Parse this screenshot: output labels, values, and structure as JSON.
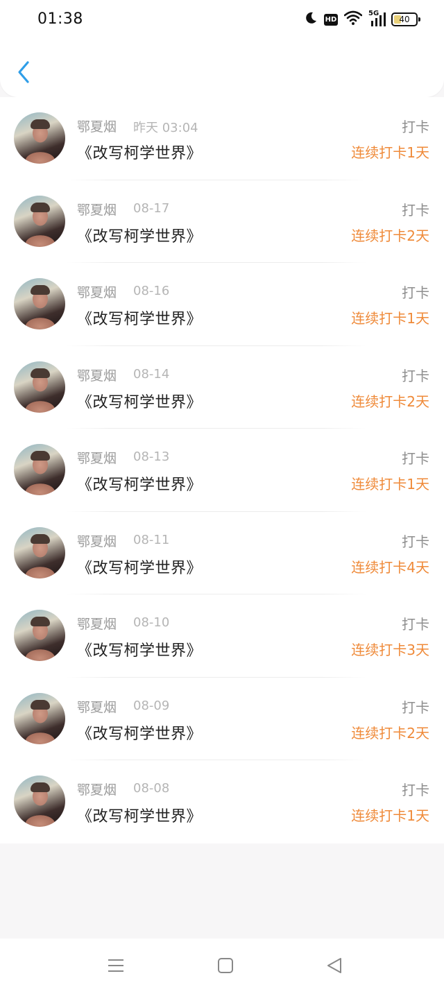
{
  "status_bar": {
    "time": "01:38",
    "hd_label": "HD",
    "network_label": "5G",
    "battery_percent": "40",
    "battery_level": 0.4
  },
  "header": {
    "back_icon": "chevron-left-icon",
    "accent_color": "#2f9ee8"
  },
  "entries": [
    {
      "name": "鄂夏烟",
      "date": "昨天 03:04",
      "title": "《改写柯学世界》",
      "type": "打卡",
      "streak": "连续打卡1天"
    },
    {
      "name": "鄂夏烟",
      "date": "08-17",
      "title": "《改写柯学世界》",
      "type": "打卡",
      "streak": "连续打卡2天"
    },
    {
      "name": "鄂夏烟",
      "date": "08-16",
      "title": "《改写柯学世界》",
      "type": "打卡",
      "streak": "连续打卡1天"
    },
    {
      "name": "鄂夏烟",
      "date": "08-14",
      "title": "《改写柯学世界》",
      "type": "打卡",
      "streak": "连续打卡2天"
    },
    {
      "name": "鄂夏烟",
      "date": "08-13",
      "title": "《改写柯学世界》",
      "type": "打卡",
      "streak": "连续打卡1天"
    },
    {
      "name": "鄂夏烟",
      "date": "08-11",
      "title": "《改写柯学世界》",
      "type": "打卡",
      "streak": "连续打卡4天"
    },
    {
      "name": "鄂夏烟",
      "date": "08-10",
      "title": "《改写柯学世界》",
      "type": "打卡",
      "streak": "连续打卡3天"
    },
    {
      "name": "鄂夏烟",
      "date": "08-09",
      "title": "《改写柯学世界》",
      "type": "打卡",
      "streak": "连续打卡2天"
    },
    {
      "name": "鄂夏烟",
      "date": "08-08",
      "title": "《改写柯学世界》",
      "type": "打卡",
      "streak": "连续打卡1天"
    }
  ],
  "colors": {
    "streak": "#ef8a39",
    "name": "#9b9b9b",
    "title": "#222222"
  },
  "navbar": {
    "items": [
      "menu-icon",
      "home-square-icon",
      "back-triangle-icon"
    ]
  }
}
